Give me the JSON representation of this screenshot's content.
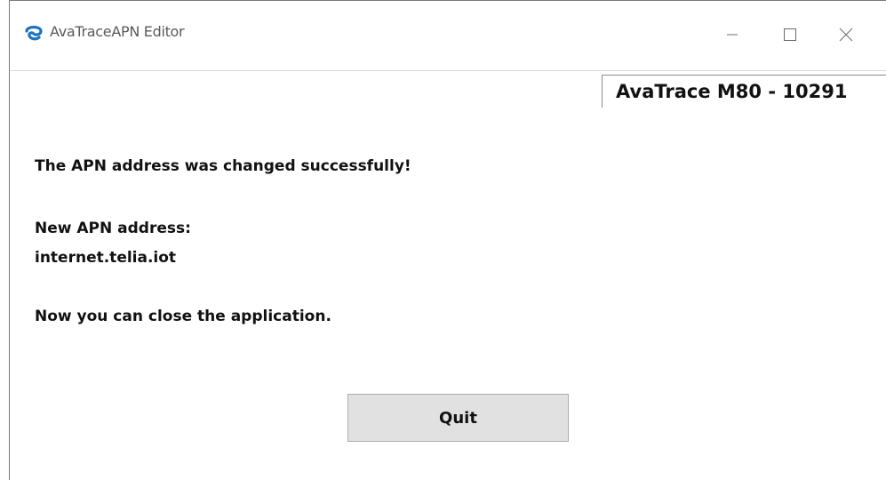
{
  "window": {
    "title": "AvaTraceAPN Editor",
    "app_icon": "avatrace-logo-icon",
    "controls": [
      "minimize-icon",
      "maximize-icon",
      "close-icon"
    ]
  },
  "device": {
    "label": "AvaTrace M80 - 10291"
  },
  "messages": {
    "success": "The APN address was changed successfully!",
    "new_apn_heading": "New APN address:",
    "new_apn_value": "internet.telia.iot",
    "close_hint": "Now you can close the application."
  },
  "actions": {
    "quit_label": "Quit"
  },
  "colors": {
    "button_bg": "#e1e1e1",
    "icon_blue": "#1e73be",
    "text": "#111111"
  }
}
